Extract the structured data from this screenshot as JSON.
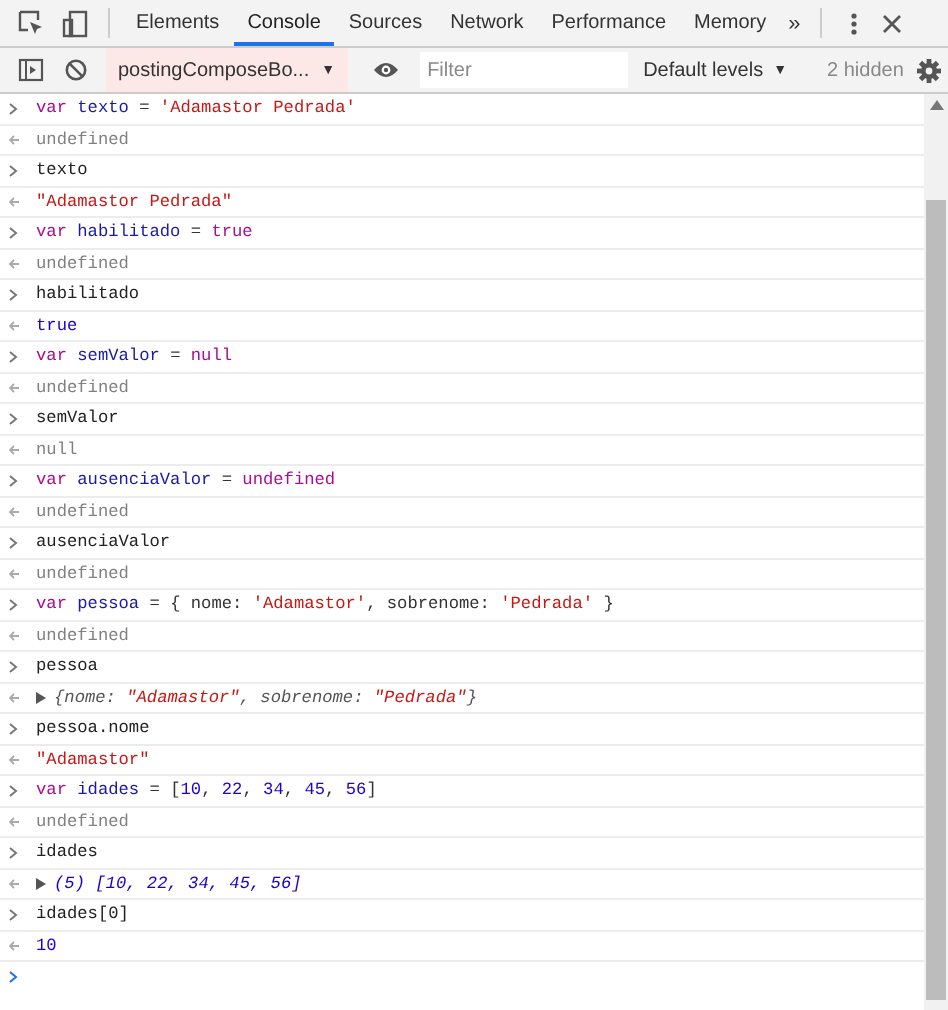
{
  "tabs": [
    {
      "label": "Elements",
      "selected": false
    },
    {
      "label": "Console",
      "selected": true
    },
    {
      "label": "Sources",
      "selected": false
    },
    {
      "label": "Network",
      "selected": false
    },
    {
      "label": "Performance",
      "selected": false
    },
    {
      "label": "Memory",
      "selected": false
    }
  ],
  "more_tabs": "»",
  "console_toolbar": {
    "context": "postingComposeBo...",
    "context_caret": "▼",
    "filter": {
      "placeholder": "Filter"
    },
    "levels": "Default levels",
    "levels_caret": "▼",
    "hidden": "2 hidden"
  },
  "entries": [
    {
      "input": [
        {
          "t": "var ",
          "kind": "keyword"
        },
        {
          "t": "texto",
          "kind": "name"
        },
        {
          "t": " = ",
          "kind": "punct"
        },
        {
          "t": "'Adamastor Pedrada'",
          "kind": "string"
        }
      ],
      "output": [
        {
          "t": "undefined",
          "kind": "muted"
        }
      ]
    },
    {
      "input": [
        {
          "t": "texto",
          "kind": "plain"
        }
      ],
      "output": [
        {
          "t": "\"Adamastor Pedrada\"",
          "kind": "string"
        }
      ]
    },
    {
      "input": [
        {
          "t": "var ",
          "kind": "keyword"
        },
        {
          "t": "habilitado",
          "kind": "name"
        },
        {
          "t": " = ",
          "kind": "punct"
        },
        {
          "t": "true",
          "kind": "keyword"
        }
      ],
      "output": [
        {
          "t": "undefined",
          "kind": "muted"
        }
      ]
    },
    {
      "input": [
        {
          "t": "habilitado",
          "kind": "plain"
        }
      ],
      "output": [
        {
          "t": "true",
          "kind": "number"
        }
      ]
    },
    {
      "input": [
        {
          "t": "var ",
          "kind": "keyword"
        },
        {
          "t": "semValor",
          "kind": "name"
        },
        {
          "t": " = ",
          "kind": "punct"
        },
        {
          "t": "null",
          "kind": "keyword"
        }
      ],
      "output": [
        {
          "t": "undefined",
          "kind": "muted"
        }
      ]
    },
    {
      "input": [
        {
          "t": "semValor",
          "kind": "plain"
        }
      ],
      "output": [
        {
          "t": "null",
          "kind": "muted"
        }
      ]
    },
    {
      "input": [
        {
          "t": "var ",
          "kind": "keyword"
        },
        {
          "t": "ausenciaValor",
          "kind": "name"
        },
        {
          "t": " = ",
          "kind": "punct"
        },
        {
          "t": "undefined",
          "kind": "keyword"
        }
      ],
      "output": [
        {
          "t": "undefined",
          "kind": "muted"
        }
      ]
    },
    {
      "input": [
        {
          "t": "ausenciaValor",
          "kind": "plain"
        }
      ],
      "output": [
        {
          "t": "undefined",
          "kind": "muted"
        }
      ]
    },
    {
      "input": [
        {
          "t": "var ",
          "kind": "keyword"
        },
        {
          "t": "pessoa",
          "kind": "name"
        },
        {
          "t": " = { nome: ",
          "kind": "punct"
        },
        {
          "t": "'Adamastor'",
          "kind": "string"
        },
        {
          "t": ", sobrenome: ",
          "kind": "punct"
        },
        {
          "t": "'Pedrada'",
          "kind": "string"
        },
        {
          "t": " }",
          "kind": "punct"
        }
      ],
      "output": [
        {
          "t": "undefined",
          "kind": "muted"
        }
      ]
    },
    {
      "input": [
        {
          "t": "pessoa",
          "kind": "plain"
        }
      ],
      "expandable": true,
      "output": [
        {
          "t": "{nome: ",
          "kind": "preview"
        },
        {
          "t": "\"Adamastor\"",
          "kind": "string"
        },
        {
          "t": ", sobrenome: ",
          "kind": "preview"
        },
        {
          "t": "\"Pedrada\"",
          "kind": "string"
        },
        {
          "t": "}",
          "kind": "preview"
        }
      ]
    },
    {
      "input": [
        {
          "t": "pessoa.nome",
          "kind": "plain"
        }
      ],
      "output": [
        {
          "t": "\"Adamastor\"",
          "kind": "string"
        }
      ]
    },
    {
      "input": [
        {
          "t": "var ",
          "kind": "keyword"
        },
        {
          "t": "idades",
          "kind": "name"
        },
        {
          "t": " = [",
          "kind": "punct"
        },
        {
          "t": "10",
          "kind": "number"
        },
        {
          "t": ", ",
          "kind": "punct"
        },
        {
          "t": "22",
          "kind": "number"
        },
        {
          "t": ", ",
          "kind": "punct"
        },
        {
          "t": "34",
          "kind": "number"
        },
        {
          "t": ", ",
          "kind": "punct"
        },
        {
          "t": "45",
          "kind": "number"
        },
        {
          "t": ", ",
          "kind": "punct"
        },
        {
          "t": "56",
          "kind": "number"
        },
        {
          "t": "]",
          "kind": "punct"
        }
      ],
      "output": [
        {
          "t": "undefined",
          "kind": "muted"
        }
      ]
    },
    {
      "input": [
        {
          "t": "idades",
          "kind": "plain"
        }
      ],
      "expandable": true,
      "output": [
        {
          "t": "(5) [10, 22, 34, 45, 56]",
          "kind": "number"
        }
      ]
    },
    {
      "input": [
        {
          "t": "idades[0]",
          "kind": "plain"
        }
      ],
      "output": [
        {
          "t": "10",
          "kind": "number"
        }
      ]
    }
  ]
}
